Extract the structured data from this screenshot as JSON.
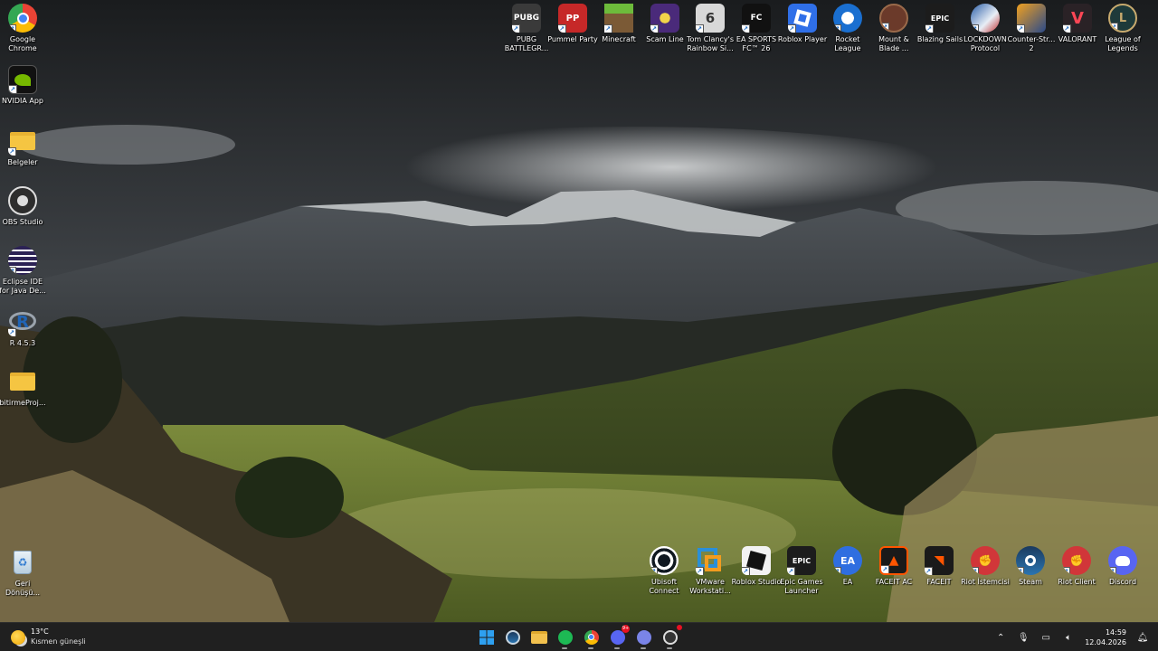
{
  "desktop": {
    "left_icons": [
      {
        "name": "google-chrome",
        "label": "Google Chrome",
        "icon": "chrome-icon"
      },
      {
        "name": "nvidia-app",
        "label": "NVIDIA App",
        "icon": "nvidia-icon"
      },
      {
        "name": "belgeler",
        "label": "Belgeler",
        "icon": "folder-icon"
      },
      {
        "name": "obs-studio",
        "label": "OBS Studio",
        "icon": "obs-icon"
      },
      {
        "name": "eclipse-ide",
        "label": "Eclipse IDE for Java De...",
        "icon": "eclipse-icon"
      },
      {
        "name": "r-453",
        "label": "R 4.5.3",
        "icon": "r-icon"
      },
      {
        "name": "bitirme-proj",
        "label": "bitirmeProj...",
        "icon": "folder-icon"
      },
      {
        "name": "recycle-bin",
        "label": "Geri Dönüşü...",
        "icon": "recycle-bin-icon"
      }
    ],
    "top_icons": [
      {
        "name": "pubg",
        "label": "PUBG BATTLEGR...",
        "icon": "pubg-icon",
        "color": "#3a3a3a"
      },
      {
        "name": "pummel-party",
        "label": "Pummel Party",
        "icon": "pummel-party-icon",
        "color": "#c62828"
      },
      {
        "name": "minecraft",
        "label": "Minecraft",
        "icon": "minecraft-icon",
        "color": "#5d8a2e"
      },
      {
        "name": "scam-line",
        "label": "Scam Line",
        "icon": "scam-line-icon",
        "color": "#4a2a7a"
      },
      {
        "name": "rainbow-six",
        "label": "Tom Clancy's Rainbow Si...",
        "icon": "rainbow-six-icon",
        "color": "#8a8a8a"
      },
      {
        "name": "ea-sports-fc",
        "label": "EA SPORTS FC™ 26",
        "icon": "ea-fc-icon",
        "color": "#111111"
      },
      {
        "name": "roblox-player",
        "label": "Roblox Player",
        "icon": "roblox-icon",
        "color": "#2f6fe8"
      },
      {
        "name": "rocket-league",
        "label": "Rocket League",
        "icon": "rocket-league-icon",
        "color": "#1a6fd0"
      },
      {
        "name": "mount-blade",
        "label": "Mount & Blade ...",
        "icon": "mount-blade-icon",
        "color": "#6b3a2a"
      },
      {
        "name": "blazing-sails",
        "label": "Blazing Sails",
        "icon": "epic-games-icon",
        "color": "#1c1c1c"
      },
      {
        "name": "lockdown-protocol",
        "label": "LOCKDOWN Protocol",
        "icon": "lockdown-icon",
        "color": "#2a5ea8"
      },
      {
        "name": "counter-strike-2",
        "label": "Counter-Str... 2",
        "icon": "cs2-icon",
        "color": "#f0a020"
      },
      {
        "name": "valorant",
        "label": "VALORANT",
        "icon": "valorant-icon",
        "color": "#2a2226"
      },
      {
        "name": "league-of-legends",
        "label": "League of Legends",
        "icon": "league-icon",
        "color": "#1e3a3a"
      }
    ],
    "bottom_icons": [
      {
        "name": "ubisoft-connect",
        "label": "Ubisoft Connect",
        "icon": "ubisoft-icon",
        "color": "#101820"
      },
      {
        "name": "vmware",
        "label": "VMware Workstati...",
        "icon": "vmware-icon",
        "color": "#2a8fd8"
      },
      {
        "name": "roblox-studio",
        "label": "Roblox Studio",
        "icon": "roblox-studio-icon",
        "color": "#111111"
      },
      {
        "name": "epic-games-launcher",
        "label": "Epic Games Launcher",
        "icon": "epic-games-icon",
        "color": "#1c1c1c"
      },
      {
        "name": "ea",
        "label": "EA",
        "icon": "ea-icon",
        "color": "#2f6ee0"
      },
      {
        "name": "faceit-ac",
        "label": "FACEIT AC",
        "icon": "faceit-ac-icon",
        "color": "#1a1a1a"
      },
      {
        "name": "faceit",
        "label": "FACEIT",
        "icon": "faceit-icon",
        "color": "#1a1a1a"
      },
      {
        "name": "riot-istemcisi",
        "label": "Riot İstemcisi",
        "icon": "riot-icon",
        "color": "#d13639"
      },
      {
        "name": "steam",
        "label": "Steam",
        "icon": "steam-icon",
        "color": "#1b3a5e"
      },
      {
        "name": "riot-client",
        "label": "Riot Client",
        "icon": "riot-icon",
        "color": "#d13639"
      },
      {
        "name": "discord",
        "label": "Discord",
        "icon": "discord-icon",
        "color": "#5865f2"
      }
    ]
  },
  "taskbar": {
    "weather": {
      "temp": "13°C",
      "condition": "Kısmen güneşli"
    },
    "apps": [
      {
        "name": "start",
        "icon": "windows-start-icon",
        "color": "#2ea0f0"
      },
      {
        "name": "steam",
        "icon": "steam-icon",
        "color": "#1b3a5e"
      },
      {
        "name": "file-explorer",
        "icon": "file-explorer-icon",
        "color": "#f2c14e"
      },
      {
        "name": "spotify",
        "icon": "spotify-icon",
        "color": "#1db954"
      },
      {
        "name": "chrome",
        "icon": "chrome-icon",
        "color": "#ea4335"
      },
      {
        "name": "discord",
        "icon": "discord-icon",
        "color": "#5865f2",
        "badge": "9+"
      },
      {
        "name": "discord-ptb",
        "icon": "discord-icon",
        "color": "#5865f2"
      },
      {
        "name": "faceit-client",
        "icon": "faceit-icon",
        "color": "#3a3a3a"
      }
    ],
    "clock": {
      "time": "14:59",
      "date": "12.04.2026"
    }
  }
}
